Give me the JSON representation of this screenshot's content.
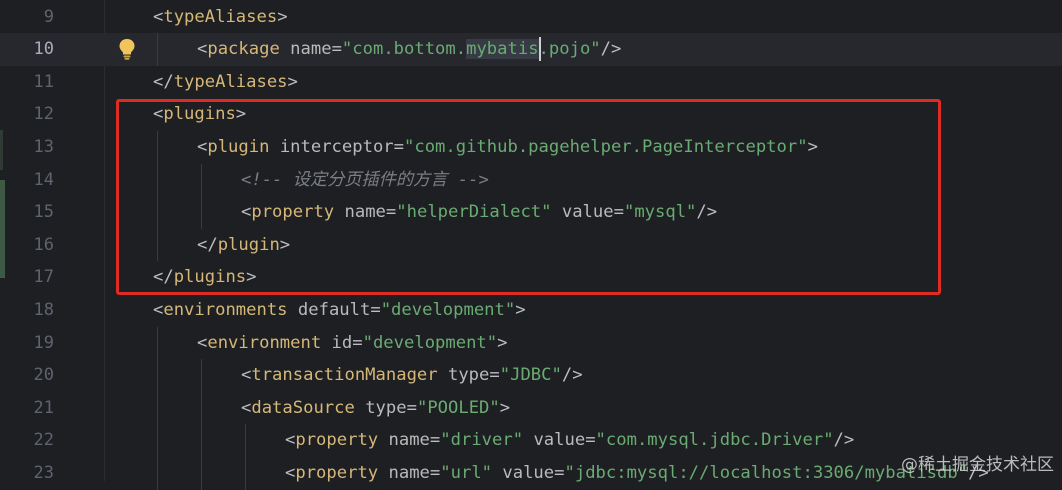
{
  "editor": {
    "lines": [
      {
        "num": "9",
        "indent": 0,
        "current": false,
        "tokens": [
          {
            "t": "<",
            "c": "br"
          },
          {
            "t": "typeAliases",
            "c": "tag"
          },
          {
            "t": ">",
            "c": "br"
          }
        ]
      },
      {
        "num": "10",
        "indent": 1,
        "current": true,
        "tokens": [
          {
            "t": "<",
            "c": "br"
          },
          {
            "t": "package",
            "c": "tag"
          },
          {
            "t": " ",
            "c": "br"
          },
          {
            "t": "name",
            "c": "attr"
          },
          {
            "t": "=",
            "c": "br"
          },
          {
            "t": "\"com.bottom.",
            "c": "val"
          },
          {
            "t": "mybatis",
            "c": "hl"
          },
          {
            "t": ".pojo\"",
            "c": "val"
          },
          {
            "t": "/>",
            "c": "br"
          }
        ]
      },
      {
        "num": "11",
        "indent": 0,
        "current": false,
        "tokens": [
          {
            "t": "</",
            "c": "br"
          },
          {
            "t": "typeAliases",
            "c": "tag"
          },
          {
            "t": ">",
            "c": "br"
          }
        ]
      },
      {
        "num": "12",
        "indent": 0,
        "current": false,
        "tokens": [
          {
            "t": "<",
            "c": "br"
          },
          {
            "t": "plugins",
            "c": "tag"
          },
          {
            "t": ">",
            "c": "br"
          }
        ]
      },
      {
        "num": "13",
        "indent": 1,
        "current": false,
        "tokens": [
          {
            "t": "<",
            "c": "br"
          },
          {
            "t": "plugin",
            "c": "tag"
          },
          {
            "t": " ",
            "c": "br"
          },
          {
            "t": "interceptor",
            "c": "attr"
          },
          {
            "t": "=",
            "c": "br"
          },
          {
            "t": "\"com.github.pagehelper.PageInterceptor\"",
            "c": "val"
          },
          {
            "t": ">",
            "c": "br"
          }
        ]
      },
      {
        "num": "14",
        "indent": 2,
        "current": false,
        "tokens": [
          {
            "t": "<!-- 设定分页插件的方言 -->",
            "c": "cmt"
          }
        ]
      },
      {
        "num": "15",
        "indent": 2,
        "current": false,
        "tokens": [
          {
            "t": "<",
            "c": "br"
          },
          {
            "t": "property",
            "c": "tag"
          },
          {
            "t": " ",
            "c": "br"
          },
          {
            "t": "name",
            "c": "attr"
          },
          {
            "t": "=",
            "c": "br"
          },
          {
            "t": "\"helperDialect\"",
            "c": "val"
          },
          {
            "t": " ",
            "c": "br"
          },
          {
            "t": "value",
            "c": "attr"
          },
          {
            "t": "=",
            "c": "br"
          },
          {
            "t": "\"mysql\"",
            "c": "val"
          },
          {
            "t": "/>",
            "c": "br"
          }
        ]
      },
      {
        "num": "16",
        "indent": 1,
        "current": false,
        "tokens": [
          {
            "t": "</",
            "c": "br"
          },
          {
            "t": "plugin",
            "c": "tag"
          },
          {
            "t": ">",
            "c": "br"
          }
        ]
      },
      {
        "num": "17",
        "indent": 0,
        "current": false,
        "tokens": [
          {
            "t": "</",
            "c": "br"
          },
          {
            "t": "plugins",
            "c": "tag"
          },
          {
            "t": ">",
            "c": "br"
          }
        ]
      },
      {
        "num": "18",
        "indent": 0,
        "current": false,
        "tokens": [
          {
            "t": "<",
            "c": "br"
          },
          {
            "t": "environments",
            "c": "tag"
          },
          {
            "t": " ",
            "c": "br"
          },
          {
            "t": "default",
            "c": "attr"
          },
          {
            "t": "=",
            "c": "br"
          },
          {
            "t": "\"development\"",
            "c": "val"
          },
          {
            "t": ">",
            "c": "br"
          }
        ]
      },
      {
        "num": "19",
        "indent": 1,
        "current": false,
        "tokens": [
          {
            "t": "<",
            "c": "br"
          },
          {
            "t": "environment",
            "c": "tag"
          },
          {
            "t": " ",
            "c": "br"
          },
          {
            "t": "id",
            "c": "attr"
          },
          {
            "t": "=",
            "c": "br"
          },
          {
            "t": "\"development\"",
            "c": "val"
          },
          {
            "t": ">",
            "c": "br"
          }
        ]
      },
      {
        "num": "20",
        "indent": 2,
        "current": false,
        "tokens": [
          {
            "t": "<",
            "c": "br"
          },
          {
            "t": "transactionManager",
            "c": "tag"
          },
          {
            "t": " ",
            "c": "br"
          },
          {
            "t": "type",
            "c": "attr"
          },
          {
            "t": "=",
            "c": "br"
          },
          {
            "t": "\"JDBC\"",
            "c": "val"
          },
          {
            "t": "/>",
            "c": "br"
          }
        ]
      },
      {
        "num": "21",
        "indent": 2,
        "current": false,
        "tokens": [
          {
            "t": "<",
            "c": "br"
          },
          {
            "t": "dataSource",
            "c": "tag"
          },
          {
            "t": " ",
            "c": "br"
          },
          {
            "t": "type",
            "c": "attr"
          },
          {
            "t": "=",
            "c": "br"
          },
          {
            "t": "\"POOLED\"",
            "c": "val"
          },
          {
            "t": ">",
            "c": "br"
          }
        ]
      },
      {
        "num": "22",
        "indent": 3,
        "current": false,
        "tokens": [
          {
            "t": "<",
            "c": "br"
          },
          {
            "t": "property",
            "c": "tag"
          },
          {
            "t": " ",
            "c": "br"
          },
          {
            "t": "name",
            "c": "attr"
          },
          {
            "t": "=",
            "c": "br"
          },
          {
            "t": "\"driver\"",
            "c": "val"
          },
          {
            "t": " ",
            "c": "br"
          },
          {
            "t": "value",
            "c": "attr"
          },
          {
            "t": "=",
            "c": "br"
          },
          {
            "t": "\"com.mysql.jdbc.Driver\"",
            "c": "val"
          },
          {
            "t": "/>",
            "c": "br"
          }
        ]
      },
      {
        "num": "23",
        "indent": 3,
        "current": false,
        "tokens": [
          {
            "t": "<",
            "c": "br"
          },
          {
            "t": "property",
            "c": "tag"
          },
          {
            "t": " ",
            "c": "br"
          },
          {
            "t": "name",
            "c": "attr"
          },
          {
            "t": "=",
            "c": "br"
          },
          {
            "t": "\"url\"",
            "c": "val"
          },
          {
            "t": " ",
            "c": "br"
          },
          {
            "t": "value",
            "c": "attr"
          },
          {
            "t": "=",
            "c": "br"
          },
          {
            "t": "\"jdbc:mysql://localhost:3306/mybatisdb\"",
            "c": "val"
          },
          {
            "t": "/>",
            "c": "br"
          }
        ]
      }
    ]
  },
  "watermark": "@稀土掘金技术社区",
  "colors": {
    "background": "#1e1f22",
    "tag": "#d5b778",
    "attribute": "#bababa",
    "string": "#6aab73",
    "comment": "#7a7e85",
    "highlight_box": "#e02b25",
    "intention_bulb": "#f2c55c"
  },
  "icons": {
    "intention": "lightbulb-icon"
  }
}
